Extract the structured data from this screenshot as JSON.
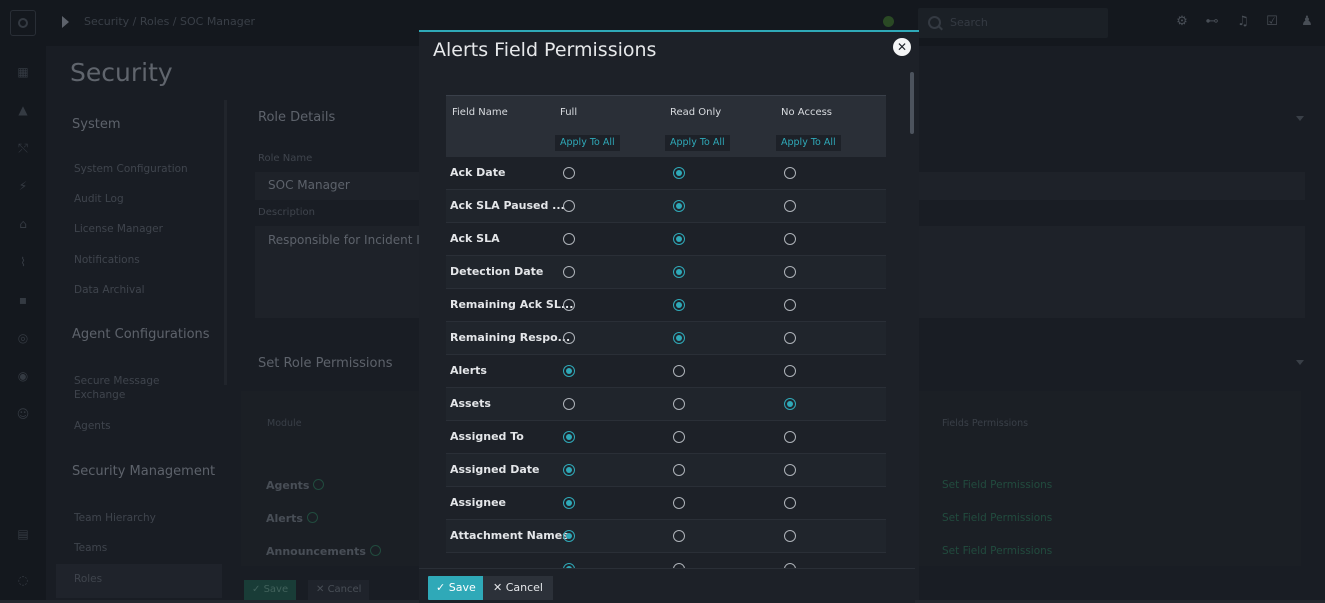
{
  "topbar": {
    "breadcrumb": "Security / Roles / SOC Manager",
    "search_placeholder": "Search",
    "icons": [
      "settings-icon",
      "network-icon",
      "bell-icon",
      "clipboard-icon",
      "user-icon"
    ]
  },
  "rail": {
    "icons": [
      "dashboard-icon",
      "incidents-icon",
      "workflow-icon",
      "automation-icon",
      "assets-icon",
      "reports-icon",
      "apps-icon",
      "connectors-icon",
      "help-icon",
      "users-icon",
      "playbook-icon",
      "settings-icon"
    ]
  },
  "page": {
    "title": "Security",
    "sidebar": {
      "system_header": "System",
      "system_items": [
        "System Configuration",
        "Audit Log",
        "License Manager",
        "Notifications",
        "Data Archival"
      ],
      "agent_header": "Agent Configurations",
      "agent_items": [
        "Secure Message Exchange",
        "Agents"
      ],
      "security_header": "Security Management",
      "security_items": [
        "Team Hierarchy",
        "Teams",
        "Roles"
      ]
    },
    "role_details": {
      "header": "Role Details",
      "role_name_label": "Role Name",
      "role_name_value": "SOC Manager",
      "description_label": "Description",
      "description_value": "Responsible for Incident In"
    },
    "permissions": {
      "header": "Set Role Permissions",
      "col_module": "Module",
      "col_fields": "Fields Permissions",
      "modules": [
        "Agents",
        "Alerts",
        "Announcements"
      ],
      "link": "Set Field Permissions"
    },
    "save_label": "Save",
    "cancel_label": "Cancel"
  },
  "modal": {
    "title": "Alerts Field Permissions",
    "columns": [
      "Field Name",
      "Full",
      "Read Only",
      "No Access"
    ],
    "apply_all": "Apply To All",
    "rows": [
      {
        "name": "Ack Date",
        "selected": "Read Only"
      },
      {
        "name": "Ack SLA Paused ...",
        "selected": "Read Only"
      },
      {
        "name": "Ack SLA",
        "selected": "Read Only"
      },
      {
        "name": "Detection Date",
        "selected": "Read Only"
      },
      {
        "name": "Remaining Ack SL...",
        "selected": "Read Only"
      },
      {
        "name": "Remaining Respo...",
        "selected": "Read Only"
      },
      {
        "name": "Alerts",
        "selected": "Full"
      },
      {
        "name": "Assets",
        "selected": "No Access"
      },
      {
        "name": "Assigned To",
        "selected": "Full"
      },
      {
        "name": "Assigned Date",
        "selected": "Full"
      },
      {
        "name": "Assignee",
        "selected": "Full"
      },
      {
        "name": "Attachment Names",
        "selected": "Full"
      },
      {
        "name": "",
        "selected": "Full"
      }
    ],
    "save_label": "Save",
    "cancel_label": "Cancel"
  },
  "colors": {
    "accent": "#2fa9b8",
    "background": "#23272e",
    "modal_background": "#1d2128"
  }
}
